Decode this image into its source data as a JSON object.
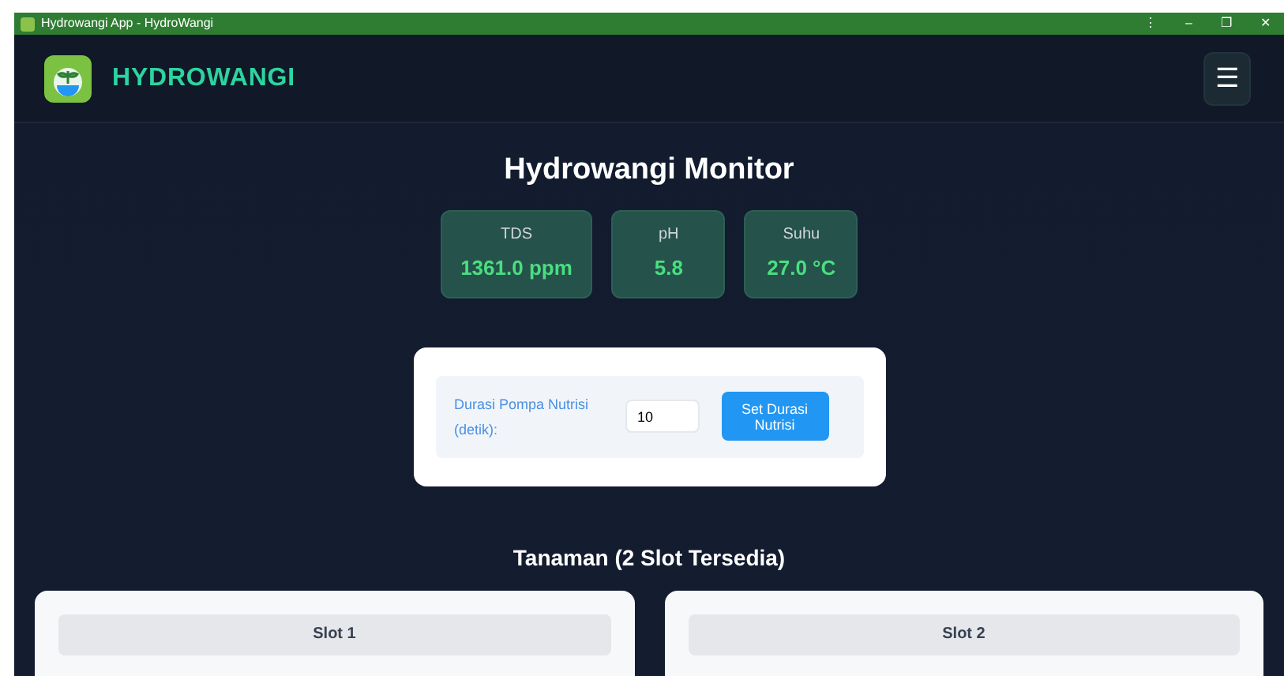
{
  "window": {
    "title": "Hydrowangi App - HydroWangi",
    "controls": [
      "⋮",
      "–",
      "❐",
      "✕"
    ]
  },
  "header": {
    "brand": "HYDROWANGI",
    "menu": "☰"
  },
  "monitor": {
    "title": "Hydrowangi Monitor",
    "readings": [
      {
        "label": "TDS",
        "value": "1361.0 ppm"
      },
      {
        "label": "pH",
        "value": "5.8"
      },
      {
        "label": "Suhu",
        "value": "27.0 °C"
      }
    ]
  },
  "pump": {
    "label": "Durasi Pompa Nutrisi (detik):",
    "value": "10",
    "button": "Set Durasi Nutrisi"
  },
  "plants": {
    "title": "Tanaman (2 Slot Tersedia)",
    "slots": [
      {
        "name": "Slot 1"
      },
      {
        "name": "Slot 2"
      }
    ]
  }
}
